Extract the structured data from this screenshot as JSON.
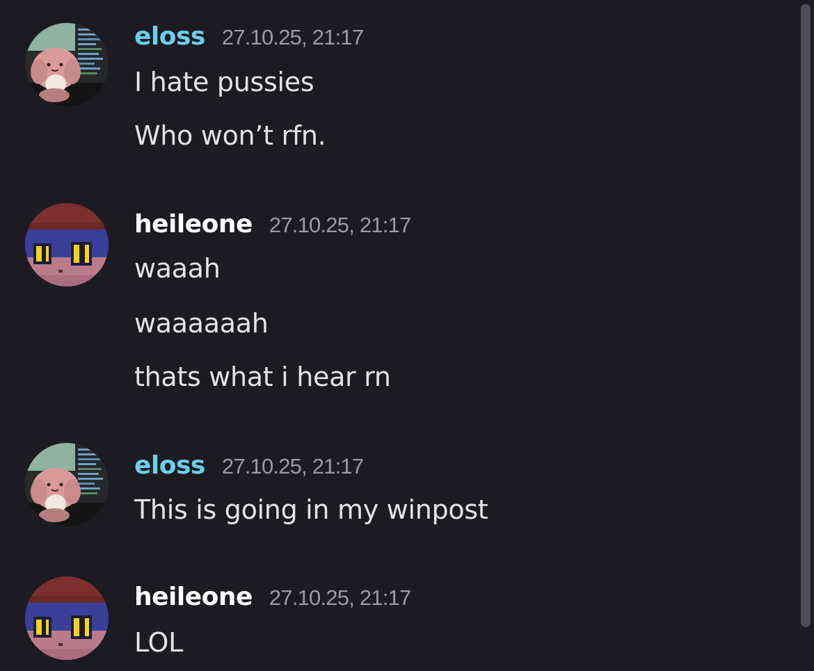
{
  "messages": [
    {
      "author": "eloss",
      "timestamp": "27.10.25, 21:17",
      "avatar": "pink-plush-avatar",
      "lines": [
        "I hate pussies",
        "Who won’t rfn."
      ]
    },
    {
      "author": "heileone",
      "timestamp": "27.10.25, 21:17",
      "avatar": "pixel-character-avatar",
      "lines": [
        "waaah",
        "waaaaaah",
        "thats what i hear rn"
      ]
    },
    {
      "author": "eloss",
      "timestamp": "27.10.25, 21:17",
      "avatar": "pink-plush-avatar",
      "lines": [
        "This is going in my winpost"
      ]
    },
    {
      "author": "heileone",
      "timestamp": "27.10.25, 21:17",
      "avatar": "pixel-character-avatar",
      "lines": [
        "LOL"
      ]
    }
  ],
  "colors": {
    "background": "#1b1b21",
    "eloss_name": "#6ccfe9",
    "heileone_name": "#ffffff",
    "timestamp": "#9a9ca6",
    "message_text": "#e3e4e8",
    "scrollbar": "#4d4e55"
  }
}
